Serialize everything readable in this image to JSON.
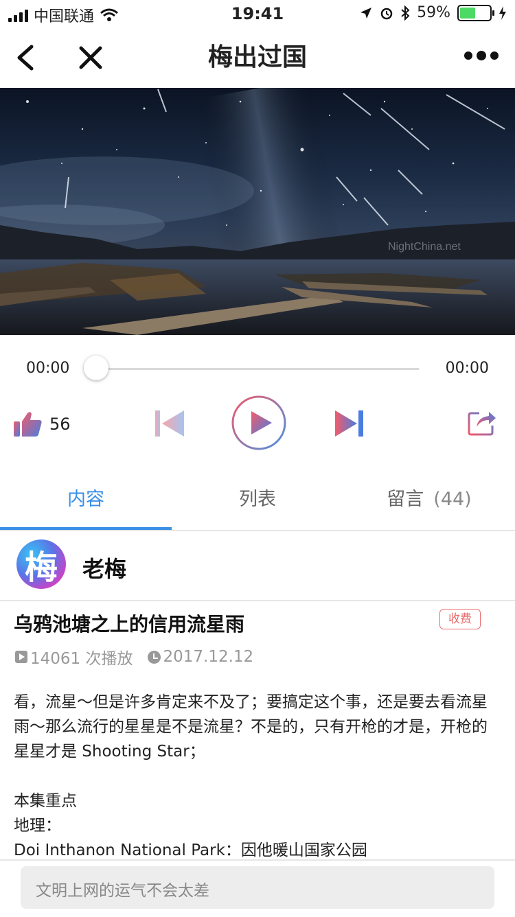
{
  "status_bar": {
    "carrier": "中国联通",
    "time": "19:41",
    "battery": "59%",
    "battery_level": 0.59
  },
  "nav": {
    "title": "梅出过国",
    "back_icon": "chevron-left-icon",
    "close_icon": "close-icon",
    "more_icon": "more-dots-icon"
  },
  "cover": {
    "watermark": "NightChina.net"
  },
  "player": {
    "current_time": "00:00",
    "total_time": "00:00",
    "progress": 0,
    "like_count": "56"
  },
  "tabs": [
    {
      "label": "内容",
      "active": true
    },
    {
      "label": "列表",
      "active": false
    },
    {
      "label": "留言",
      "count": "(44)",
      "active": false
    }
  ],
  "author": {
    "avatar_char": "梅",
    "name": "老梅"
  },
  "episode": {
    "title": "乌鸦池塘之上的信用流星雨",
    "badge": "收费",
    "plays": "14061 次播放",
    "date": "2017.12.12",
    "description": [
      "看，流星～但是许多肯定来不及了；要搞定这个事，还是要去看流星雨～那么流行的星星是不是流星？不是的，只有开枪的才是，开枪的星星才是 Shooting Star；",
      "",
      "本集重点",
      "地理：",
      "Doi Inthanon National Park：因他暖山国家公园"
    ]
  },
  "comment": {
    "placeholder": "文明上网的运气不会太差"
  },
  "colors": {
    "accent": "#3a8ee6",
    "fee": "#e96a6a",
    "like_gradient": [
      "#f25b6b",
      "#4a7de0"
    ]
  }
}
